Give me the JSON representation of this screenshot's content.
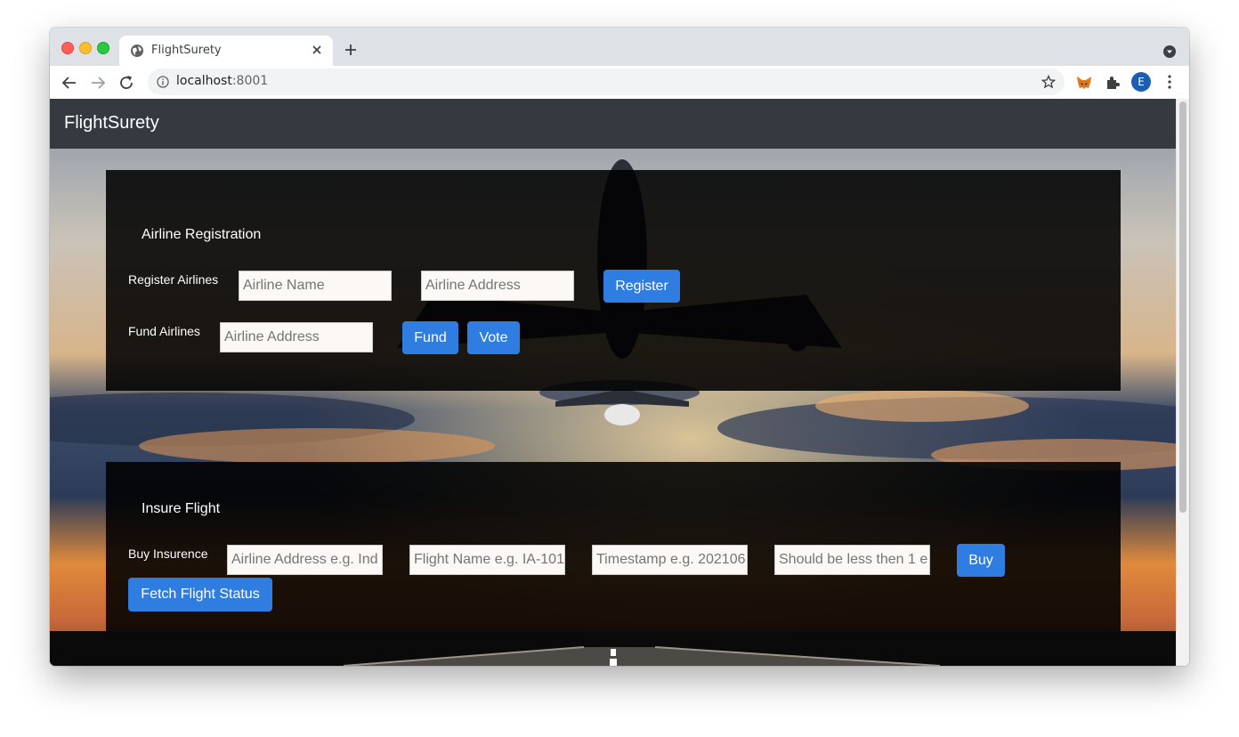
{
  "browser": {
    "tab_title": "FlightSurety",
    "url_host": "localhost",
    "url_port": ":8001",
    "profile_initial": "E"
  },
  "navbar": {
    "brand": "FlightSurety"
  },
  "registration": {
    "title": "Airline Registration",
    "register_label": "Register Airlines",
    "airline_name_placeholder": "Airline Name",
    "airline_address_placeholder": "Airline Address",
    "register_button": "Register",
    "fund_label": "Fund Airlines",
    "fund_address_placeholder": "Airline Address",
    "fund_button": "Fund",
    "vote_button": "Vote"
  },
  "insurance": {
    "title": "Insure Flight",
    "buy_label": "Buy Insurence",
    "airline_placeholder": "Airline Address e.g. Ind",
    "flight_placeholder": "Flight Name e.g. IA-101",
    "timestamp_placeholder": "Timestamp e.g. 202106",
    "amount_placeholder": "Should be less then 1 e",
    "buy_button": "Buy",
    "fetch_button": "Fetch Flight Status"
  },
  "colors": {
    "button_primary": "#2f7de1",
    "navbar": "#343a40",
    "panel": "#000000"
  },
  "icons": [
    "globe-icon",
    "close-icon",
    "plus-icon",
    "chevron-down-icon",
    "back-arrow-icon",
    "forward-arrow-icon",
    "reload-icon",
    "info-icon",
    "star-icon",
    "metamask-fox-icon",
    "puzzle-icon",
    "kebab-menu-icon",
    "airplane-icon"
  ]
}
